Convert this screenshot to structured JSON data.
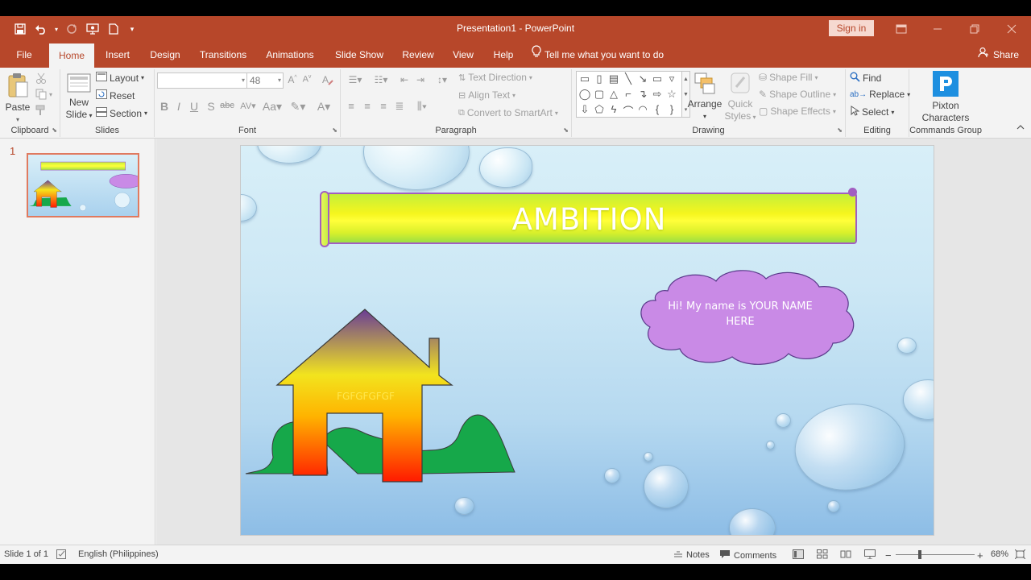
{
  "titlebar": {
    "title": "Presentation1  -  PowerPoint",
    "signin": "Sign in"
  },
  "tabs": [
    "File",
    "Home",
    "Insert",
    "Design",
    "Transitions",
    "Animations",
    "Slide Show",
    "Review",
    "View",
    "Help"
  ],
  "tell_me": "Tell me what you want to do",
  "share": "Share",
  "ribbon": {
    "clipboard": {
      "paste": "Paste",
      "label": "Clipboard"
    },
    "slides": {
      "new_slide_1": "New",
      "new_slide_2": "Slide",
      "layout": "Layout",
      "reset": "Reset",
      "section": "Section",
      "label": "Slides"
    },
    "font": {
      "font_name": "",
      "font_size": "48",
      "label": "Font"
    },
    "paragraph": {
      "text_direction": "Text Direction",
      "align_text": "Align Text",
      "convert_smartart": "Convert to SmartArt",
      "label": "Paragraph"
    },
    "drawing": {
      "arrange": "Arrange",
      "quick_styles_1": "Quick",
      "quick_styles_2": "Styles",
      "shape_fill": "Shape Fill",
      "shape_outline": "Shape Outline",
      "shape_effects": "Shape Effects",
      "label": "Drawing"
    },
    "editing": {
      "find": "Find",
      "replace": "Replace",
      "select": "Select",
      "label": "Editing"
    },
    "pixton": {
      "line1": "Pixton",
      "line2": "Characters",
      "label": "Commands Group"
    }
  },
  "thumbnail": {
    "number": "1"
  },
  "slide": {
    "title": "AMBITION",
    "cloud_text": "Hi! My name is YOUR NAME HERE",
    "house_text": "FGFGFGFGF"
  },
  "statusbar": {
    "slide_info": "Slide 1 of 1",
    "language": "English (Philippines)",
    "notes": "Notes",
    "comments": "Comments",
    "zoom": "68%"
  },
  "colors": {
    "accent": "#b7472a",
    "banner_border": "#a25ec1",
    "cloud_fill": "#c98ae6",
    "house_top": "#6a3d96",
    "house_bottom": "#ff1a00",
    "hill_green": "#16a84a"
  }
}
